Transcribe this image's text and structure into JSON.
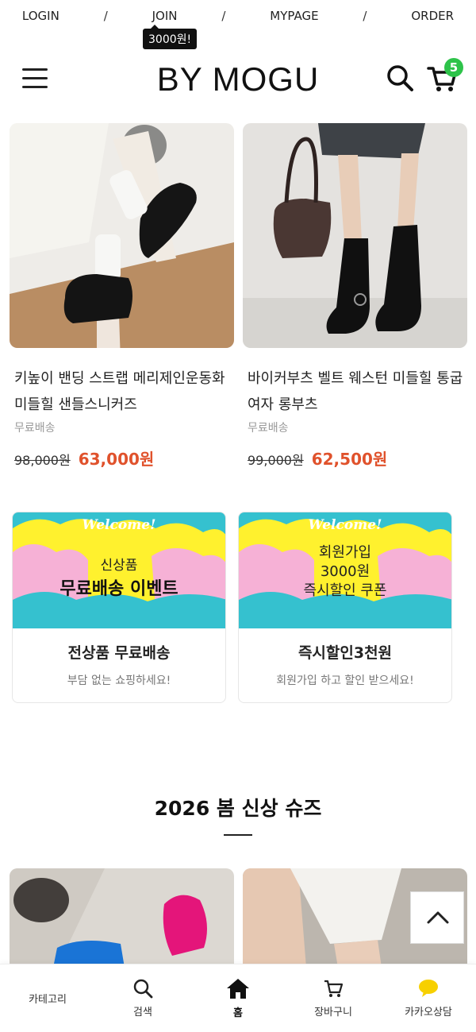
{
  "top_links": {
    "login": "LOGIN",
    "join": "JOIN",
    "mypage": "MYPAGE",
    "order": "ORDER",
    "separator": "/"
  },
  "join_tooltip": "3000원!",
  "header": {
    "logo": "BY MOGU",
    "cart_count": "5"
  },
  "products": [
    {
      "name": "키높이 밴딩 스트랩 메리제인운동화 미들힐 샌들스니커즈",
      "shipping": "무료배송",
      "original_price": "98,000원",
      "sale_price": "63,000원"
    },
    {
      "name": "바이커부츠 벨트 웨스턴 미들힐 통굽 여자 롱부츠",
      "shipping": "무료배송",
      "original_price": "99,000원",
      "sale_price": "62,500원"
    }
  ],
  "events": [
    {
      "banner_welcome": "Welcome!",
      "banner_line1": "신상품",
      "banner_line2": "무료배송 이벤트",
      "title": "전상품 무료배송",
      "desc": "부담 없는 쇼핑하세요!"
    },
    {
      "banner_welcome": "Welcome!",
      "banner_line1": "회원가입",
      "banner_line2": "3000원",
      "banner_line3": "즉시할인 쿠폰",
      "title": "즉시할인3천원",
      "desc": "회원가입 하고 할인 받으세요!"
    }
  ],
  "section": {
    "title": "2026 봄 신상 슈즈"
  },
  "bottom_nav": {
    "category": "카테고리",
    "search": "검색",
    "home": "홈",
    "cart": "장바구니",
    "kakao": "카카오상담"
  },
  "colors": {
    "sale_price": "#e0522c",
    "cart_badge": "#2ec34a",
    "banner_cyan": "#35c1cf",
    "banner_yellow": "#fff12e",
    "banner_pink": "#f6b1d6",
    "kakao": "#f7d000"
  }
}
